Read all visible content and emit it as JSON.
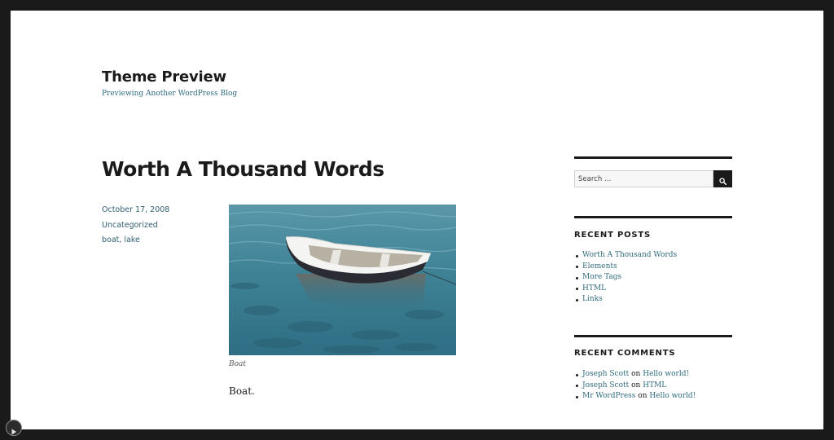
{
  "site": {
    "title": "Theme Preview",
    "description": "Previewing Another WordPress Blog"
  },
  "post": {
    "title": "Worth A Thousand Words",
    "date": "October 17, 2008",
    "category": "Uncategorized",
    "tags": "boat, lake",
    "image_caption": "Boat",
    "body": "Boat."
  },
  "sidebar": {
    "search_placeholder": "Search …",
    "search_icon": "search-icon",
    "recent_posts": {
      "title": "RECENT POSTS",
      "items": [
        "Worth A Thousand Words",
        "Elements",
        "More Tags",
        "HTML",
        "Links"
      ]
    },
    "recent_comments": {
      "title": "RECENT COMMENTS",
      "items": [
        {
          "author": "Joseph Scott",
          "on": "on",
          "post": "Hello world!"
        },
        {
          "author": "Joseph Scott",
          "on": "on",
          "post": "HTML"
        },
        {
          "author": "Mr WordPress",
          "on": "on",
          "post": "Hello world!"
        }
      ]
    }
  },
  "player": {
    "icon": "play-icon"
  },
  "colors": {
    "link": "#2f6b7d",
    "text": "#1a1a1a",
    "frame": "#1a1a1a"
  }
}
